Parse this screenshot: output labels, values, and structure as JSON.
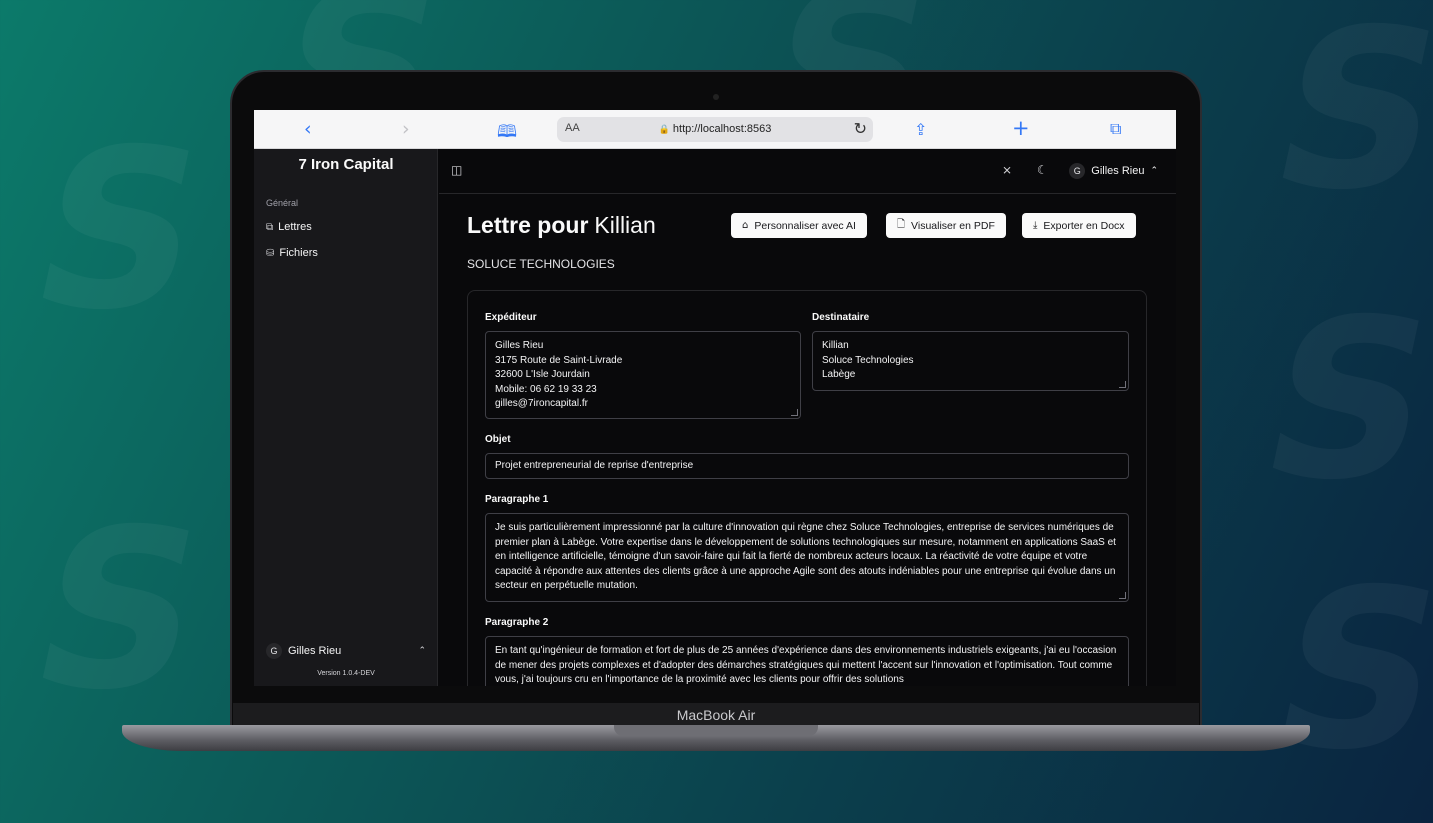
{
  "laptop": {
    "model_label": "MacBook Air"
  },
  "browser": {
    "aa_label": "AA",
    "url": "http://localhost:8563"
  },
  "sidebar": {
    "brand": "7 Iron Capital",
    "group_label": "Général",
    "items": [
      {
        "label": "Lettres",
        "icon": "letters-icon"
      },
      {
        "label": "Fichiers",
        "icon": "database-icon"
      }
    ],
    "user": {
      "initial": "G",
      "name": "Gilles Rieu"
    },
    "version": "Version 1.0.4-DEV"
  },
  "topbar": {
    "user": {
      "initial": "G",
      "name": "Gilles Rieu"
    }
  },
  "main": {
    "title_prefix": "Lettre pour",
    "recipient_name": "Killian",
    "company": "SOLUCE TECHNOLOGIES",
    "buttons": {
      "personalize": "Personnaliser avec AI",
      "pdf": "Visualiser en PDF",
      "docx": "Exporter en Docx"
    },
    "form": {
      "sender_label": "Expéditeur",
      "sender_value": "Gilles Rieu\n3175 Route de Saint-Livrade\n32600 L'Isle Jourdain\nMobile: 06 62 19 33 23\ngilles@7ironcapital.fr",
      "recipient_label": "Destinataire",
      "recipient_value": "Killian\nSoluce Technologies\nLabège",
      "subject_label": "Objet",
      "subject_value": "Projet entrepreneurial de reprise d'entreprise",
      "p1_label": "Paragraphe 1",
      "p1_value": "Je suis particulièrement impressionné par la culture d'innovation qui règne chez Soluce Technologies, entreprise de services numériques de premier plan à Labège. Votre expertise dans le développement de solutions technologiques sur mesure, notamment en applications SaaS et en intelligence artificielle, témoigne d'un savoir-faire qui fait la fierté de nombreux acteurs locaux. La réactivité de votre équipe et votre capacité à répondre aux attentes des clients grâce à une approche Agile sont des atouts indéniables pour une entreprise qui évolue dans un secteur en perpétuelle mutation.",
      "p2_label": "Paragraphe 2",
      "p2_value": "En tant qu'ingénieur de formation et fort de plus de 25 années d'expérience dans des environnements industriels exigeants, j'ai eu l'occasion de mener des projets complexes et d'adopter des démarches stratégiques qui mettent l'accent sur l'innovation et l'optimisation. Tout comme vous, j'ai toujours cru en l'importance de la proximité avec les clients pour offrir des solutions"
    }
  }
}
